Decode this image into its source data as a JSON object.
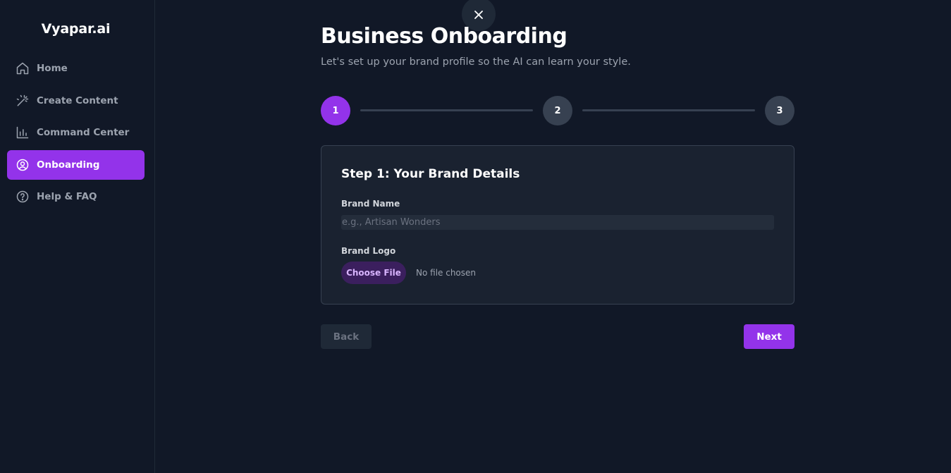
{
  "brand": {
    "name": "Vyapar.ai"
  },
  "sidebar": {
    "items": [
      {
        "label": "Home",
        "icon": "home-icon",
        "active": false
      },
      {
        "label": "Create Content",
        "icon": "magic-wand-icon",
        "active": false
      },
      {
        "label": "Command Center",
        "icon": "bar-chart-icon",
        "active": false
      },
      {
        "label": "Onboarding",
        "icon": "user-circle-icon",
        "active": true
      },
      {
        "label": "Help & FAQ",
        "icon": "help-circle-icon",
        "active": false
      }
    ]
  },
  "close": {
    "icon": "close-icon"
  },
  "page": {
    "title": "Business Onboarding",
    "subtitle": "Let's set up your brand profile so the AI can learn your style."
  },
  "stepper": {
    "steps": [
      "1",
      "2",
      "3"
    ],
    "current_step": 1
  },
  "form": {
    "title": "Step 1: Your Brand Details",
    "brand_name_label": "Brand Name",
    "brand_name_placeholder": "e.g., Artisan Wonders",
    "brand_name_value": "",
    "brand_logo_label": "Brand Logo",
    "choose_file_label": "Choose File",
    "file_status": "No file chosen"
  },
  "actions": {
    "back_label": "Back",
    "next_label": "Next"
  },
  "colors": {
    "background": "#111827",
    "accent": "#9333ea",
    "card": "#1a2230",
    "muted": "#374151"
  }
}
